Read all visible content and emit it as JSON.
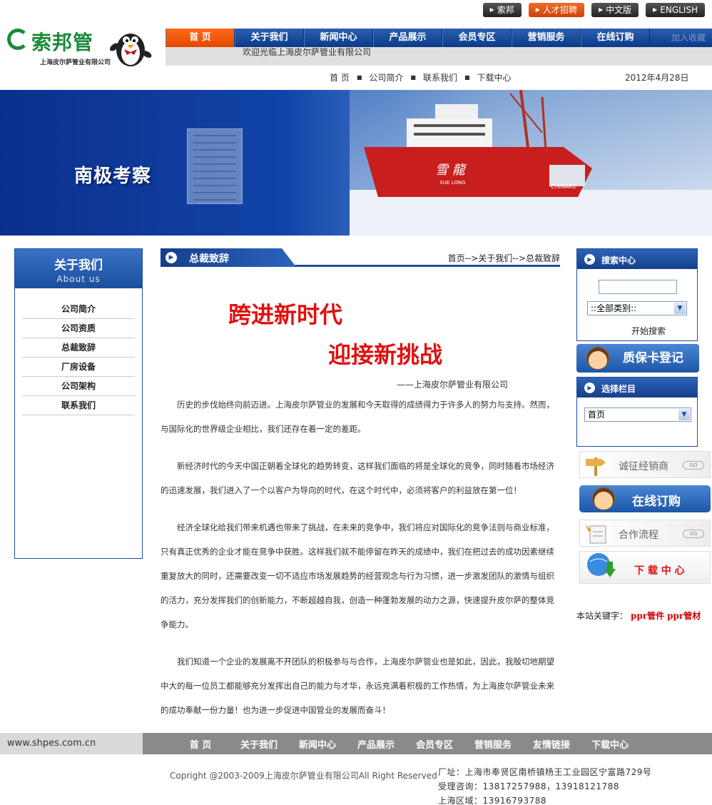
{
  "top_buttons": [
    {
      "label": "索邦",
      "color": "#333333"
    },
    {
      "label": "人才招聘",
      "color": "#e24800"
    },
    {
      "label": "中文版",
      "color": "#333333"
    },
    {
      "label": "ENGLISH",
      "color": "#333333"
    }
  ],
  "logo": {
    "brand": "索邦管",
    "sub": "上海皮尔萨管业有限公司"
  },
  "nav": {
    "items": [
      "首 页",
      "关于我们",
      "新闻中心",
      "产品展示",
      "会员专区",
      "营销服务",
      "在线订购"
    ],
    "tail": "加入收藏",
    "active_color": "#e24800",
    "bar_color": "#1c4fa0"
  },
  "welcome": "欢迎光临上海皮尔萨管业有限公司",
  "subnav": [
    "首 页",
    "公司简介",
    "联系我们",
    "下载中心"
  ],
  "date": "2012年4月28日",
  "banner": {
    "title": "南极考察",
    "ship_name": "雪 龍",
    "ship_en": "XUE LONG",
    "ship_hull": "CHINARE"
  },
  "left": {
    "title": "关于我们",
    "subtitle": "About us",
    "items": [
      "公司简介",
      "公司资质",
      "总裁致辞",
      "厂房设备",
      "公司架构",
      "联系我们"
    ]
  },
  "main": {
    "section_title": "总裁致辞",
    "breadcrumb": "首页-->关于我们-->总裁致辞",
    "headline1": "跨进新时代",
    "headline2": "迎接新挑战",
    "signature": "——上海皮尔萨管业有限公司",
    "paragraphs": [
      "历史的步伐始终向前迈进。上海皮尔萨管业的发展和今天取得的成绩得力于许多人的努力与支持。然而，与国际化的世界级企业相比，我们还存在着一定的差距。",
      "新经济时代的今天中国正朝着全球化的趋势转变，这样我们面临的将是全球化的竞争，同时随着市场经济的迅速发展，我们进入了一个以客户为导向的时代，在这个时代中，必须将客户的利益放在第一位！",
      "经济全球化给我们带来机遇也带来了挑战，在未来的竞争中，我们将应对国际化的竞争法则与商业标准，只有真正优秀的企业才能在竞争中获胜。这样我们就不能停留在昨天的成绩中，我们在把过去的成功因素继续重复放大的同时，还需要改变一切不适应市场发展趋势的经营观念与行为习惯，进一步激发团队的激情与组织的活力，充分发挥我们的创新能力，不断超越自我，创造一种蓬勃发展的动力之源，快速提升皮尔萨的整体竞争能力。",
      "我们知道一个企业的发展离不开团队的积极参与与合作，上海皮尔萨管业也是如此，因此，我殷切地期望中大的每一位员工都能够充分发挥出自己的能力与才华，永远充满着积极的工作热情，为上海皮尔萨管业未来的成功奉献一份力量！也为进一步促进中国管业的发展而奋斗！"
    ]
  },
  "search": {
    "title": "搜索中心",
    "input_value": "",
    "category_selected": "::全部类别::",
    "submit_label": "开始搜索"
  },
  "warranty_label": "质保卡登记",
  "column_select": {
    "title": "选择栏目",
    "selected": "首页"
  },
  "promos": {
    "dealer": "诚征经销商",
    "order": "在线订购",
    "process": "合作流程",
    "download": "下 载 中 心",
    "go_label": "GO"
  },
  "keywords": {
    "label": "本站关键字：",
    "words": [
      "ppr管件",
      "ppr管材"
    ]
  },
  "footer": {
    "site": "www.shpes.com.cn",
    "links": [
      "首 页",
      "关于我们",
      "新闻中心",
      "产品展示",
      "会员专区",
      "营销服务",
      "友情链接",
      "下载中心"
    ],
    "copyright": "Copright @2003-2009上海皮尔萨管业有限公司All Right Reserved",
    "address": "厂址：上海市奉贤区南桥镇杨王工业园区宁富路729号",
    "hotline": "受理咨询：13817257988，13918121788",
    "shanghai": "上海区域：13916793788"
  }
}
